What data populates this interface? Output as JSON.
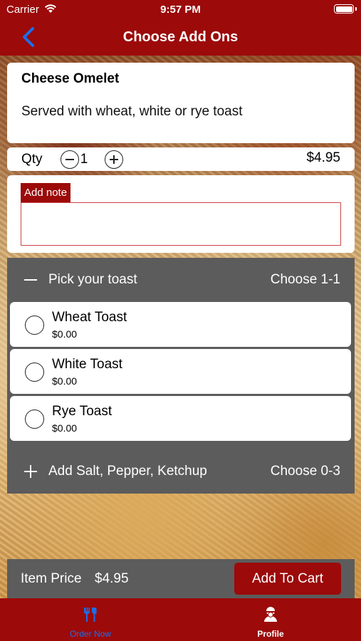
{
  "status_bar": {
    "carrier": "Carrier",
    "time": "9:57 PM"
  },
  "nav": {
    "title": "Choose Add Ons"
  },
  "item": {
    "name": "Cheese Omelet",
    "description": "Served with wheat, white or rye toast",
    "qty_label": "Qty",
    "qty": "1",
    "price": "$4.95"
  },
  "note": {
    "label": "Add note",
    "value": ""
  },
  "groups": [
    {
      "title": "Pick your toast",
      "choose": "Choose 1-1",
      "expanded": true,
      "options": [
        {
          "name": "Wheat Toast",
          "price": "$0.00"
        },
        {
          "name": "White Toast",
          "price": "$0.00"
        },
        {
          "name": "Rye Toast",
          "price": "$0.00"
        }
      ]
    },
    {
      "title": "Add Salt, Pepper, Ketchup",
      "choose": "Choose 0-3",
      "expanded": false
    }
  ],
  "footer": {
    "item_price_label": "Item Price",
    "item_price": "$4.95",
    "add_to_cart": "Add To Cart"
  },
  "tabs": [
    {
      "label": "Order Now",
      "icon": "utensils-icon",
      "active": true
    },
    {
      "label": "Profile",
      "icon": "chef-icon",
      "active": false
    }
  ],
  "colors": {
    "brand_red": "#9c0a0a",
    "group_gray": "#5c5c5c",
    "back_blue": "#1b6fe8"
  }
}
